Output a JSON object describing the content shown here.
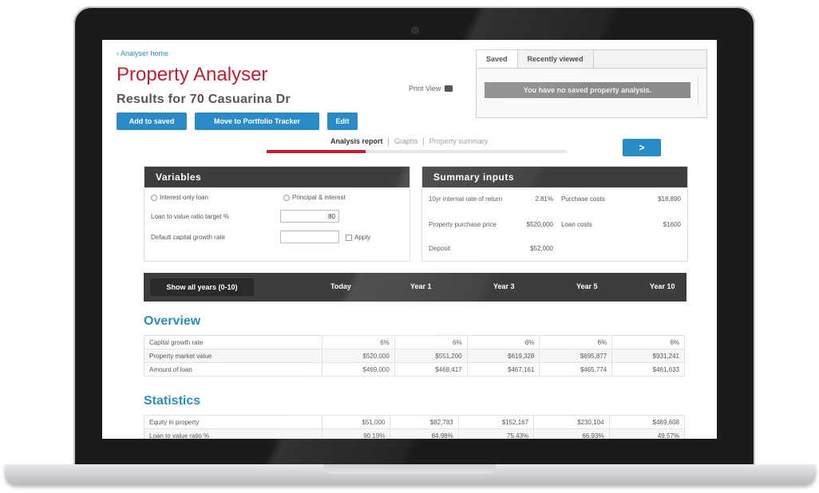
{
  "app": {
    "back_link": "Analyser home",
    "title": "Property Analyser",
    "subtitle": "Results for 70 Casuarina Dr"
  },
  "actions": {
    "add_to_saved": "Add to saved",
    "move_to_portfolio": "Move to Portfolio Tracker",
    "edit": "Edit",
    "print_view": "Print View"
  },
  "saved_panel": {
    "tabs": [
      "Saved",
      "Recently viewed"
    ],
    "message": "You have no saved property analysis."
  },
  "report_tabs": {
    "items": [
      "Analysis report",
      "Graphs",
      "Property summary"
    ],
    "separator": "|",
    "active_index": 0,
    "progress_fraction": 0.33,
    "next_label": ">"
  },
  "variables": {
    "title": "Variables",
    "interest_only": "Interest only loan",
    "principal_interest": "Principal & interest",
    "lvr_label": "Loan to value ratio target %",
    "lvr_value": "80",
    "growth_label": "Default capital growth rate",
    "growth_value": "",
    "apply": "Apply"
  },
  "summary": {
    "title": "Summary inputs",
    "rows": [
      {
        "label": "10yr internal rate of return",
        "value": "2.81%",
        "label2": "Purchase costs",
        "value2": "$18,890"
      },
      {
        "label": "Property purchase price",
        "value": "$520,000",
        "label2": "Loan costs",
        "value2": "$1600"
      },
      {
        "label": "Deposit",
        "value": "$52,000",
        "label2": "",
        "value2": ""
      }
    ]
  },
  "years": {
    "show_all": "Show all years (0-10)",
    "headers": [
      "Today",
      "Year 1",
      "Year 3",
      "Year 5",
      "Year 10"
    ]
  },
  "overview": {
    "title": "Overview",
    "rows": [
      {
        "label": "Capital growth rate",
        "values": [
          "6%",
          "6%",
          "6%",
          "6%",
          "6%"
        ]
      },
      {
        "label": "Property market value",
        "values": [
          "$520,000",
          "$551,200",
          "$619,328",
          "$695,877",
          "$931,241"
        ]
      },
      {
        "label": "Amount of loan",
        "values": [
          "$469,000",
          "$468,417",
          "$467,161",
          "$465,774",
          "$461,633"
        ]
      }
    ]
  },
  "statistics": {
    "title": "Statistics",
    "rows": [
      {
        "label": "Equity in property",
        "values": [
          "$51,000",
          "$82,783",
          "$152,167",
          "$230,104",
          "$469,608"
        ]
      },
      {
        "label": "Loan to value ratio %",
        "values": [
          "90.19%",
          "84.98%",
          "75.43%",
          "66.93%",
          "49.57%"
        ]
      }
    ]
  }
}
